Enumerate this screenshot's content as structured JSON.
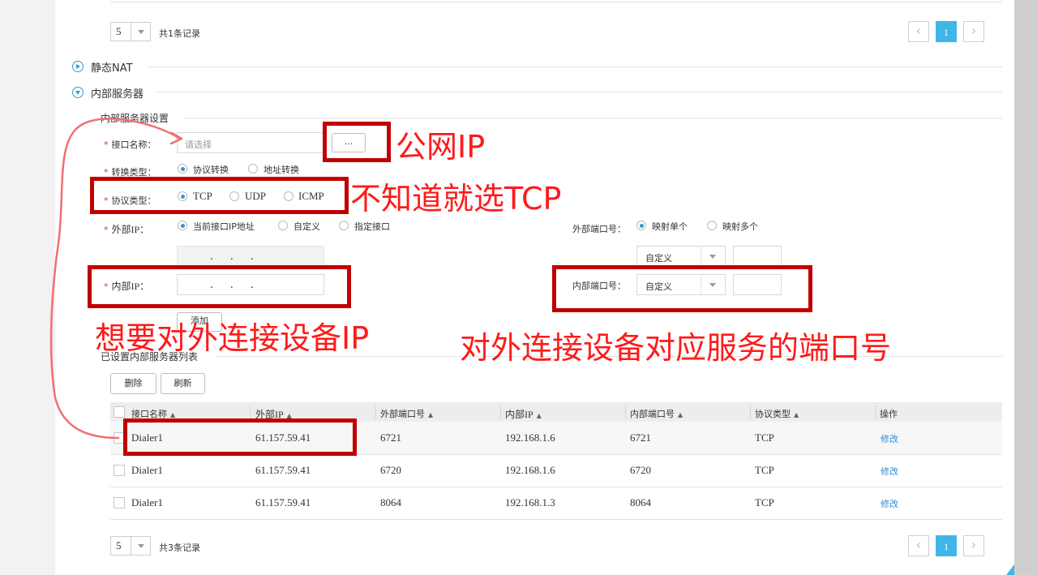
{
  "top_pager": {
    "page_size": "5",
    "total": "共1条记录",
    "prev": "‹",
    "current_page": "1",
    "next": "›"
  },
  "static_nat": {
    "title": "静态NAT"
  },
  "internal_server": {
    "title": "内部服务器",
    "settings_title": "内部服务器设置",
    "interface_name": {
      "label": "接口名称：",
      "placeholder": "请选择",
      "browse_label": "..."
    },
    "conversion_type": {
      "label": "转换类型：",
      "options": [
        "协议转换",
        "地址转换"
      ],
      "selected": "协议转换"
    },
    "protocol_type": {
      "label": "协议类型：",
      "options": [
        "TCP",
        "UDP",
        "ICMP"
      ],
      "selected": "TCP"
    },
    "external_ip": {
      "label": "外部IP：",
      "options": [
        "当前接口IP地址",
        "自定义",
        "指定接口"
      ],
      "selected": "当前接口IP地址",
      "ip_dots": ".     .     ."
    },
    "external_port": {
      "label": "外部端口号：",
      "options": [
        "映射单个",
        "映射多个"
      ],
      "selected": "映射单个",
      "select_value": "自定义"
    },
    "internal_ip": {
      "label": "内部IP：",
      "ip_dots": ".     .     ."
    },
    "internal_port": {
      "label": "内部端口号：",
      "select_value": "自定义"
    },
    "add_button": "添加",
    "required_mark": "*"
  },
  "server_list": {
    "title": "已设置内部服务器列表",
    "delete_button": "删除",
    "refresh_button": "刷新",
    "columns": [
      "接口名称",
      "外部IP",
      "外部端口号",
      "内部IP",
      "内部端口号",
      "协议类型",
      "操作"
    ],
    "sort_marker": "▲",
    "rows": [
      {
        "interface": "Dialer1",
        "external_ip": "61.157.59.41",
        "external_port": "6721",
        "internal_ip": "192.168.1.6",
        "internal_port": "6721",
        "protocol": "TCP",
        "action": "修改"
      },
      {
        "interface": "Dialer1",
        "external_ip": "61.157.59.41",
        "external_port": "6720",
        "internal_ip": "192.168.1.6",
        "internal_port": "6720",
        "protocol": "TCP",
        "action": "修改"
      },
      {
        "interface": "Dialer1",
        "external_ip": "61.157.59.41",
        "external_port": "8064",
        "internal_ip": "192.168.1.3",
        "internal_port": "8064",
        "protocol": "TCP",
        "action": "修改"
      }
    ]
  },
  "bottom_pager": {
    "page_size": "5",
    "total": "共3条记录",
    "prev": "‹",
    "current_page": "1",
    "next": "›"
  },
  "annotations": {
    "public_ip": "公网IP",
    "tcp_hint": "不知道就选TCP",
    "device_ip": "想要对外连接设备IP",
    "device_port": "对外连接设备对应服务的端口号"
  },
  "colors": {
    "accent": "#3fb6e8",
    "link": "#2d8fd5",
    "annotation_red": "#ff1a1a",
    "box_red": "#c00000",
    "required_red": "#e03030"
  }
}
